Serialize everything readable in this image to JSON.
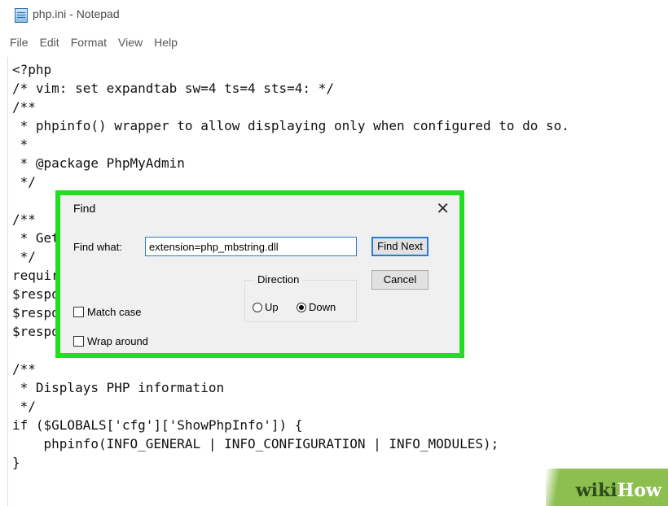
{
  "window": {
    "title": "php.ini - Notepad",
    "icon": "notepad-icon"
  },
  "menu": [
    "File",
    "Edit",
    "Format",
    "View",
    "Help"
  ],
  "code_lines": [
    "<?php",
    "/* vim: set expandtab sw=4 ts=4 sts=4: */",
    "/**",
    " * phpinfo() wrapper to allow displaying only when configured to do so.",
    " *",
    " * @package PhpMyAdmin",
    " */",
    "",
    "/**",
    " * Get",
    " */",
    "requir",
    "$respo",
    "$respo",
    "$respo",
    "",
    "/**",
    " * Displays PHP information",
    " */",
    "if ($GLOBALS['cfg']['ShowPhpInfo']) {",
    "    phpinfo(INFO_GENERAL | INFO_CONFIGURATION | INFO_MODULES);",
    "}"
  ],
  "find_dialog": {
    "title": "Find",
    "close_icon": "close-icon",
    "find_what_label": "Find what:",
    "find_what_value": "extension=php_mbstring.dll",
    "find_next_label": "Find Next",
    "cancel_label": "Cancel",
    "direction_label": "Direction",
    "up_label": "Up",
    "down_label": "Down",
    "direction_selected": "Down",
    "match_case_label": "Match case",
    "match_case_checked": false,
    "wrap_around_label": "Wrap around",
    "wrap_around_checked": false
  },
  "highlight_color": "#1fe01f",
  "watermark": {
    "wiki": "wiki",
    "how": "How"
  }
}
